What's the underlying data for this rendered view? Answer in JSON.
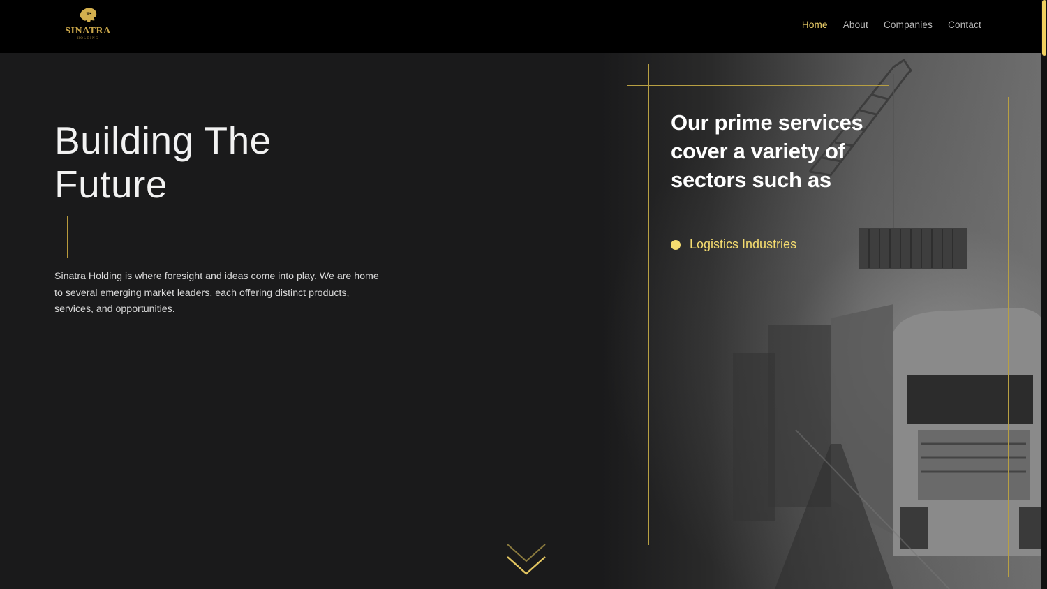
{
  "header": {
    "logo": {
      "name": "SINATRA",
      "sub": "HOLDING"
    },
    "nav": [
      {
        "label": "Home",
        "active": true
      },
      {
        "label": "About",
        "active": false
      },
      {
        "label": "Companies",
        "active": false
      },
      {
        "label": "Contact",
        "active": false
      }
    ]
  },
  "hero": {
    "title": "Building The Future",
    "description": "Sinatra Holding is where foresight and ideas come into play. We are home to several emerging market leaders, each offering distinct products, services, and opportunities."
  },
  "sectors": {
    "heading": "Our prime services cover a variety of sectors such as",
    "items": [
      "Logistics Industries"
    ]
  },
  "icons": {
    "logo": "lion-head-icon",
    "scroll": "chevron-down-icon",
    "bullet": "dot-icon"
  },
  "colors": {
    "accent": "#f5dc6f",
    "gold": "#c9a64a",
    "header_bg": "#000000",
    "page_bg": "#1a1a1b"
  }
}
